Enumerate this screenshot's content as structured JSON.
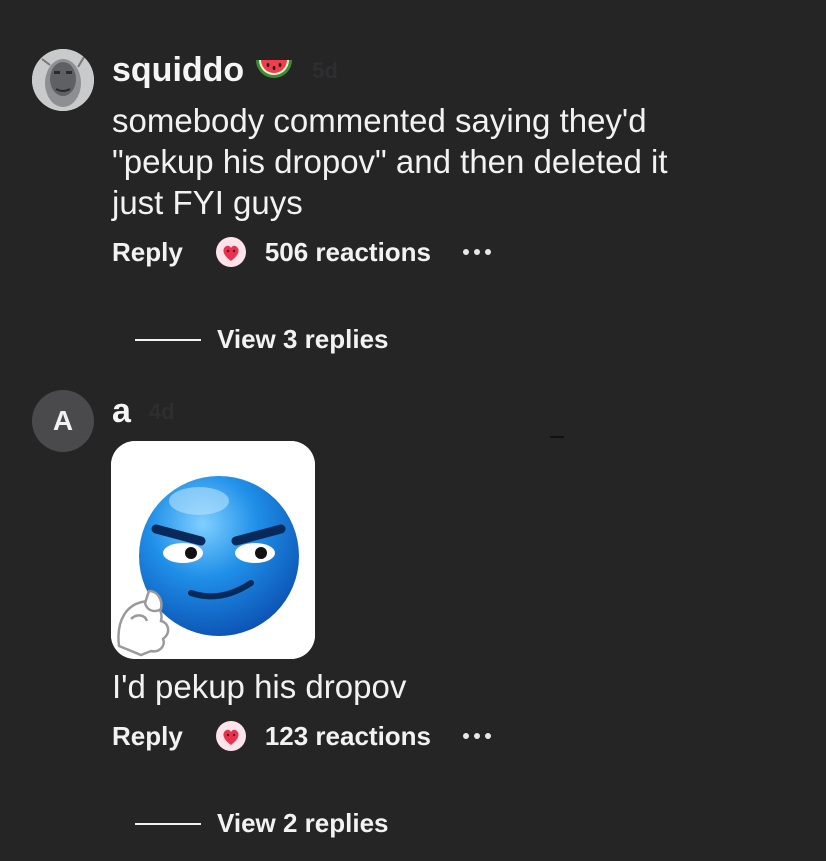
{
  "comments": [
    {
      "username": "squiddo",
      "username_emoji": "watermelon-icon",
      "faint_time": "5d",
      "text": "somebody commented saying they'd\n\"pekup his dropov\" and then deleted it\njust FYI guys",
      "reply_label": "Reply",
      "reactions_label": "506 reactions",
      "reaction_icon": "heart-face-icon",
      "view_replies_label": "View 3 replies"
    },
    {
      "username": "a",
      "avatar_letter": "A",
      "faint_time": "4d",
      "sticker_icon": "blue-smirk-emoji-sticker",
      "text": "I'd pekup his dropov",
      "reply_label": "Reply",
      "reactions_label": "123 reactions",
      "reaction_icon": "heart-face-icon",
      "view_replies_label": "View 2 replies"
    }
  ],
  "colors": {
    "background": "#252526",
    "text": "#f2f2f2",
    "reaction_bubble": "#fde3ea",
    "reaction_heart": "#e8324f",
    "sticker_blue": "#1f7fe0"
  }
}
